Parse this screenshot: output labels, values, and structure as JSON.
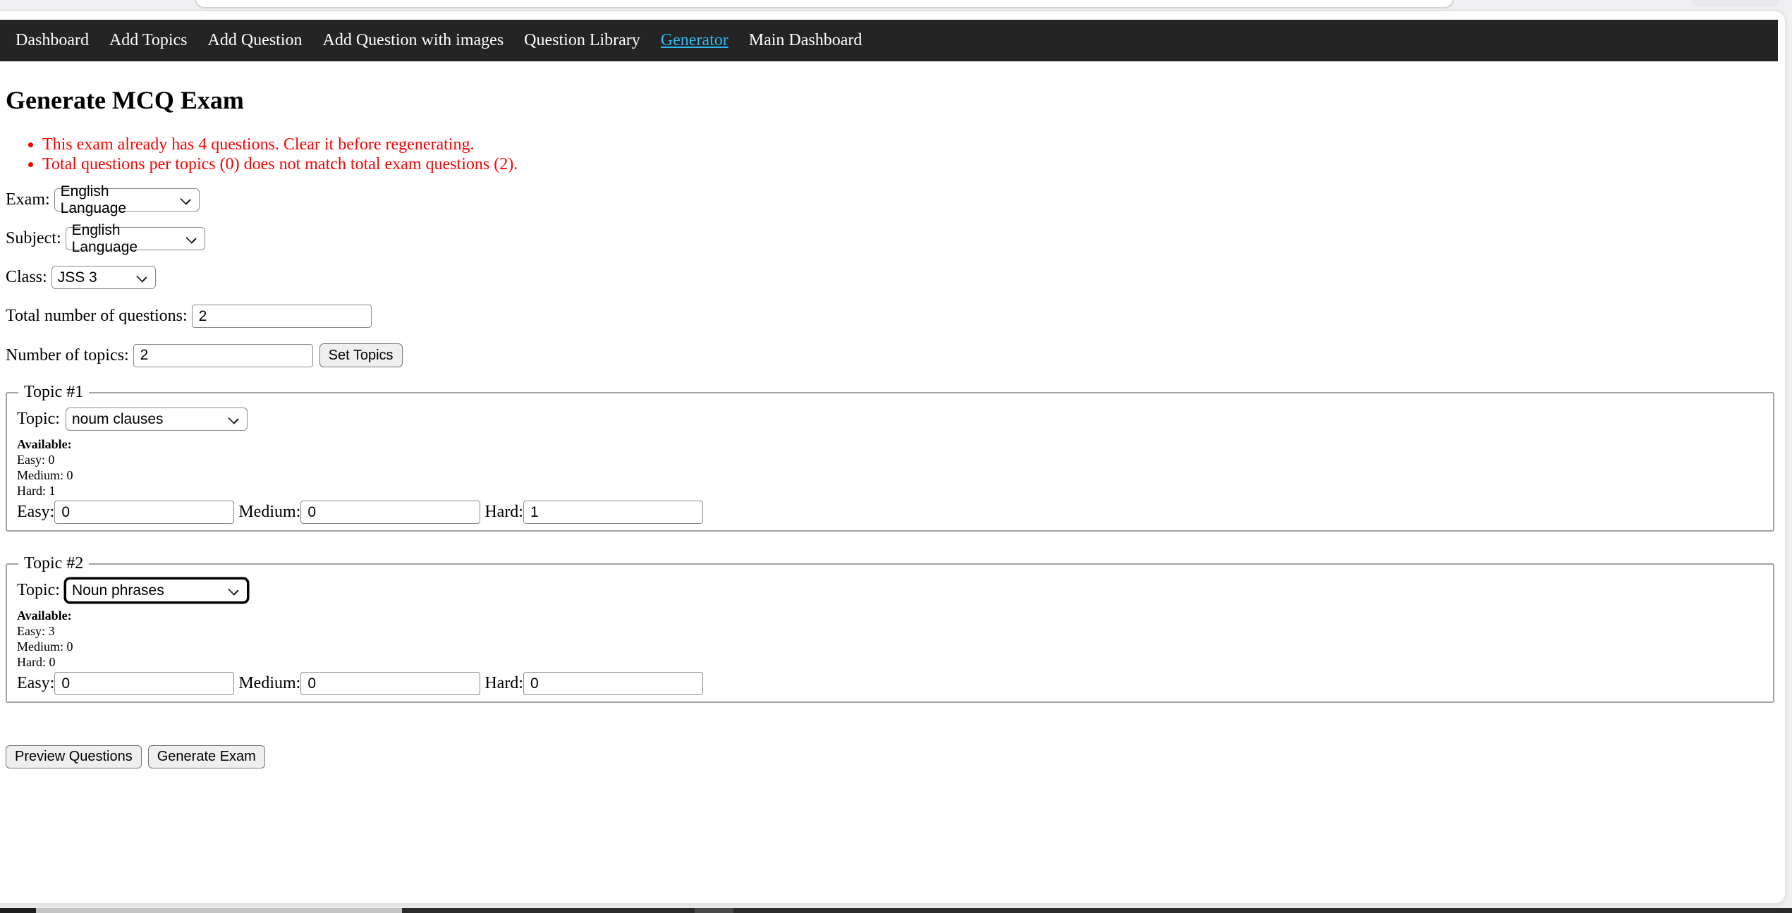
{
  "nav": {
    "items": [
      {
        "label": "Dashboard"
      },
      {
        "label": "Add Topics"
      },
      {
        "label": "Add Question"
      },
      {
        "label": "Add Question with images"
      },
      {
        "label": "Question Library"
      },
      {
        "label": "Generator",
        "active": true
      },
      {
        "label": "Main Dashboard"
      }
    ],
    "active_color": "#2eb8f2",
    "background": "#242424"
  },
  "page": {
    "title": "Generate MCQ Exam"
  },
  "errors": [
    "This exam already has 4 questions. Clear it before regenerating.",
    "Total questions per topics (0) does not match total exam questions (2).",
    "color:#fe0000"
  ],
  "fields": {
    "exam": {
      "label": "Exam:",
      "value": "English Language"
    },
    "subject": {
      "label": "Subject:",
      "value": "English Language"
    },
    "class": {
      "label": "Class:",
      "value": "JSS 3"
    },
    "total_questions": {
      "label": "Total number of questions:",
      "value": "2"
    },
    "num_topics": {
      "label": "Number of topics:",
      "value": "2"
    },
    "set_topics_button": "Set Topics"
  },
  "topics": [
    {
      "legend": "Topic #1",
      "topic_label": "Topic:",
      "topic_value": "noum clauses",
      "available_label": "Available:",
      "available_easy": "Easy: 0",
      "available_medium": "Medium: 0",
      "available_hard": "Hard: 1",
      "easy_label": "Easy:",
      "easy_value": "0",
      "medium_label": "Medium:",
      "medium_value": "0",
      "hard_label": "Hard:",
      "hard_value": "1"
    },
    {
      "legend": "Topic #2",
      "topic_label": "Topic:",
      "topic_value": "Noun phrases",
      "available_label": "Available:",
      "available_easy": "Easy: 3",
      "available_medium": "Medium: 0",
      "available_hard": "Hard: 0",
      "easy_label": "Easy:",
      "easy_value": "0",
      "medium_label": "Medium:",
      "medium_value": "0",
      "hard_label": "Hard:",
      "hard_value": "0",
      "focused": true
    }
  ],
  "actions": {
    "preview": "Preview Questions",
    "generate": "Generate Exam"
  }
}
